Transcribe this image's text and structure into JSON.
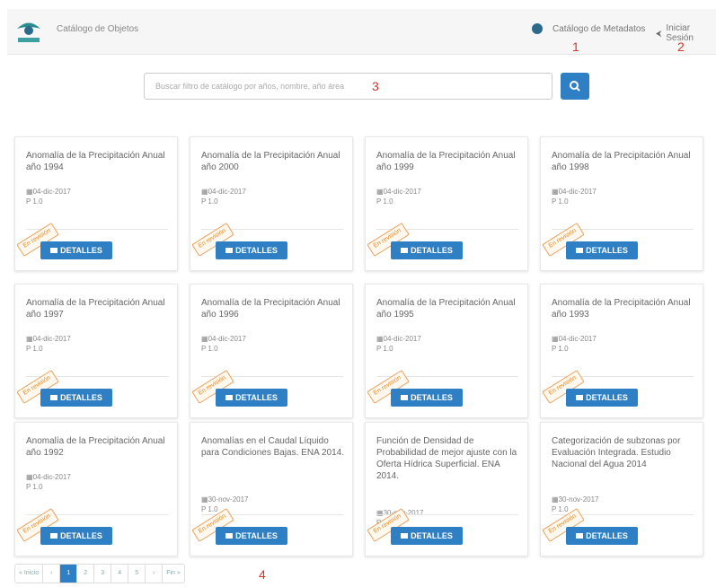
{
  "navbar": {
    "brand": "Catálogo de Objetos",
    "link_catalog": "Catálogo de Metadatos",
    "link_login": "Iniciar Sesión"
  },
  "search": {
    "placeholder": "Buscar filtro de catálogo por años, nombre, año área"
  },
  "annotations": [
    "1",
    "2",
    "3",
    "4"
  ],
  "cards": [
    {
      "title": "Anomalía de la Precipitación Anual año 1994",
      "date": "04-dic-2017",
      "version": "P 1.0",
      "ribbon": "En revisión",
      "button": "DETALLES"
    },
    {
      "title": "Anomalía de la Precipitación Anual año 2000",
      "date": "04-dic-2017",
      "version": "P 1.0",
      "ribbon": "En revisión",
      "button": "DETALLES"
    },
    {
      "title": "Anomalía de la Precipitación Anual año 1999",
      "date": "04-dic-2017",
      "version": "P 1.0",
      "ribbon": "En revisión",
      "button": "DETALLES"
    },
    {
      "title": "Anomalía de la Precipitación Anual año 1998",
      "date": "04-dic-2017",
      "version": "P 1.0",
      "ribbon": "En revisión",
      "button": "DETALLES"
    },
    {
      "title": "Anomalía de la Precipitación Anual año 1997",
      "date": "04-dic-2017",
      "version": "P 1.0",
      "ribbon": "En revisión",
      "button": "DETALLES"
    },
    {
      "title": "Anomalía de la Precipitación Anual año 1996",
      "date": "04-dic-2017",
      "version": "P 1.0",
      "ribbon": "En revisión",
      "button": "DETALLES"
    },
    {
      "title": "Anomalía de la Precipitación Anual año 1995",
      "date": "04-dic-2017",
      "version": "P 1.0",
      "ribbon": "En revisión",
      "button": "DETALLES"
    },
    {
      "title": "Anomalía de la Precipitación Anual año 1993",
      "date": "04-dic-2017",
      "version": "P 1.0",
      "ribbon": "En revisión",
      "button": "DETALLES"
    },
    {
      "title": "Anomalía de la Precipitación Anual año 1992",
      "date": "04-dic-2017",
      "version": "P 1.0",
      "ribbon": "En revisión",
      "button": "DETALLES"
    },
    {
      "title": "Anomalías en el Caudal Líquido para Condiciones Bajas. ENA 2014.",
      "date": "30-nov-2017",
      "version": "P 1.0",
      "ribbon": "En revisión",
      "button": "DETALLES"
    },
    {
      "title": "Función de Densidad de Probabilidad de mejor ajuste con la Oferta Hídrica Superficial. ENA 2014.",
      "date": "30-nov-2017",
      "version": "P 1.0",
      "ribbon": "En revisión",
      "button": "DETALLES"
    },
    {
      "title": "Categorización de subzonas por Evaluación Integrada. Estudio Nacional del Agua 2014",
      "date": "30-nov-2017",
      "version": "P 1.0",
      "ribbon": "En revisión",
      "button": "DETALLES"
    }
  ],
  "pagination": [
    "« Inicio",
    "‹",
    "1",
    "2",
    "3",
    "4",
    "5",
    "›",
    "Fin »"
  ],
  "colors": {
    "primary": "#2f7fc4",
    "ribbon": "#e9891e",
    "annotation": "#d9342b"
  }
}
